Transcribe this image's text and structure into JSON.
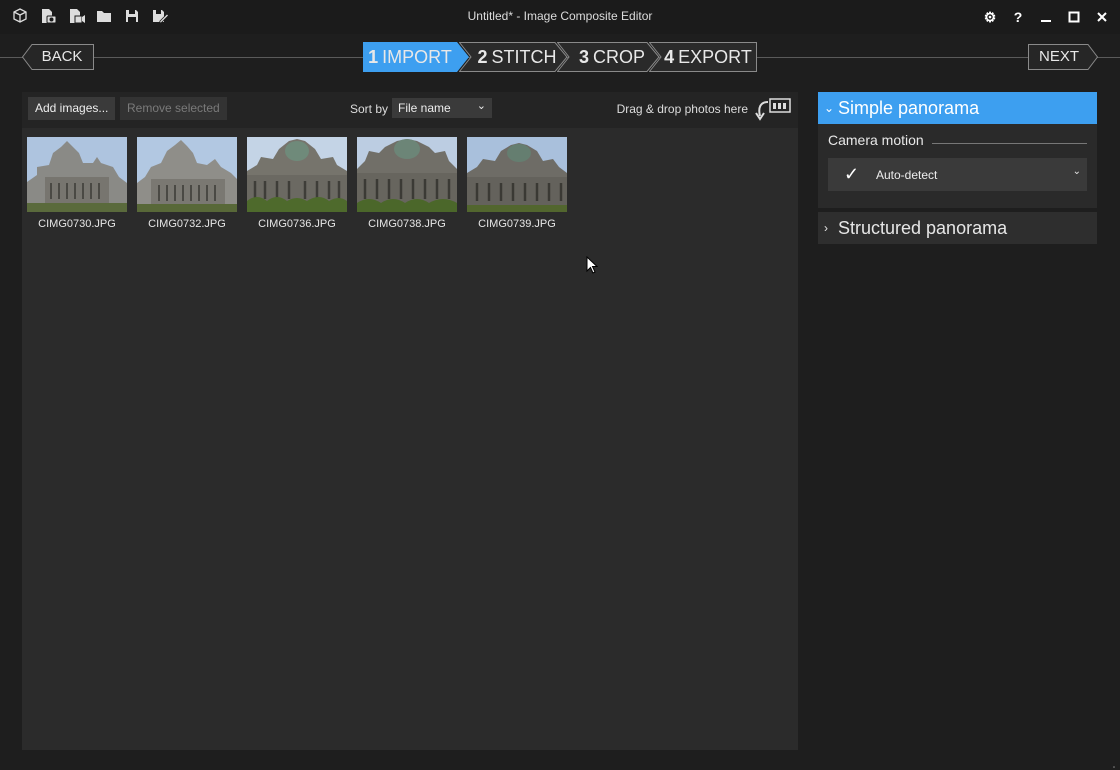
{
  "window": {
    "title": "Untitled* - Image Composite Editor"
  },
  "titlebar_icons": [
    "new-project-icon",
    "new-panorama-from-images-icon",
    "new-panorama-from-video-icon",
    "open-folder-icon",
    "save-icon",
    "save-as-icon"
  ],
  "window_controls": {
    "settings": "⚙",
    "help": "?",
    "minimize": "‒",
    "maximize": "□",
    "close": "✕"
  },
  "nav": {
    "back": "BACK",
    "next": "NEXT"
  },
  "steps": [
    {
      "num": "1",
      "label": "IMPORT",
      "active": true
    },
    {
      "num": "2",
      "label": "STITCH",
      "active": false
    },
    {
      "num": "3",
      "label": "CROP",
      "active": false
    },
    {
      "num": "4",
      "label": "EXPORT",
      "active": false
    }
  ],
  "toolbar": {
    "add_images": "Add images...",
    "remove_selected": "Remove selected",
    "sort_by_label": "Sort by",
    "sort_value": "File name",
    "drop_hint": "Drag & drop photos here"
  },
  "images": [
    {
      "name": "CIMG0730.JPG"
    },
    {
      "name": "CIMG0732.JPG"
    },
    {
      "name": "CIMG0736.JPG"
    },
    {
      "name": "CIMG0738.JPG"
    },
    {
      "name": "CIMG0739.JPG"
    }
  ],
  "side": {
    "simple": {
      "title": "Simple panorama",
      "expanded": true
    },
    "camera_motion_label": "Camera motion",
    "camera_motion_value": "Auto-detect",
    "structured": {
      "title": "Structured panorama",
      "expanded": false
    }
  },
  "colors": {
    "accent": "#3d9ff0",
    "background": "#1e1e1e",
    "panel": "#2b2b2b"
  }
}
